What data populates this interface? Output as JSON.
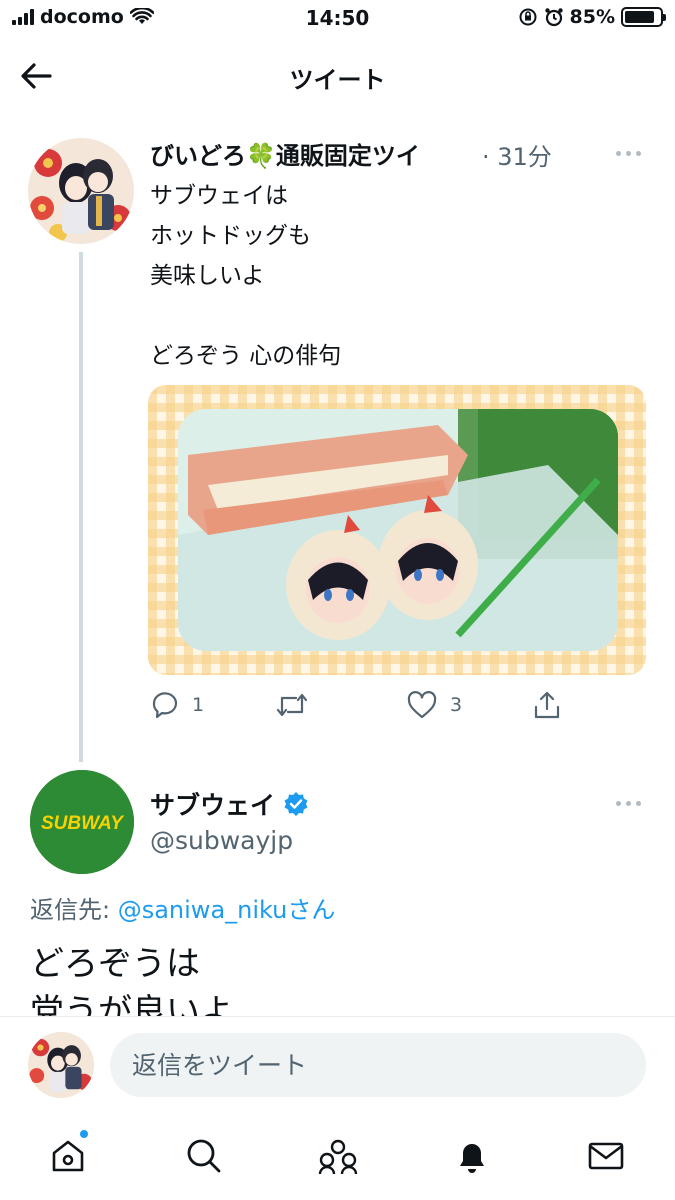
{
  "status_bar": {
    "carrier": "docomo",
    "time": "14:50",
    "battery": "85%",
    "battery_level": 0.85
  },
  "header": {
    "title": "ツイート",
    "back_icon": "arrow-left-icon"
  },
  "tweet_original": {
    "display_name": "びいどろ🍀通販固定ツイ",
    "meta": "· 31分",
    "text": "サブウェイは\nホットドッグも\n美味しいよ\n\nどろぞう 心の俳句",
    "actions": {
      "reply_count": "1",
      "retweet_count": "",
      "like_count": "3"
    }
  },
  "tweet_reply": {
    "display_name": "サブウェイ",
    "handle": "@subwayjp",
    "avatar_logo": "SUBWAY",
    "reply_to_prefix": "返信先: ",
    "reply_to_user": "@saniwa_niku",
    "reply_to_suffix": "さん",
    "text": "どろぞうは\n党うが良いよ"
  },
  "reply_bar": {
    "placeholder": "返信をツイート"
  },
  "colors": {
    "accent": "#1d9bf0",
    "subway_green": "#2d8a35",
    "subway_yellow": "#f6d300",
    "muted": "#536471"
  },
  "nav": {
    "items": [
      "home-icon",
      "search-icon",
      "communities-icon",
      "notifications-icon",
      "messages-icon"
    ]
  }
}
